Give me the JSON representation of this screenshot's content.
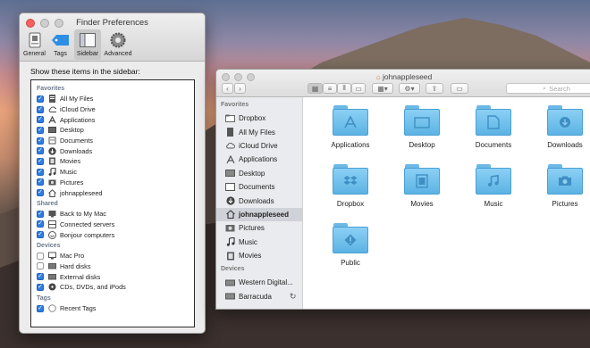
{
  "preferences": {
    "title": "Finder Preferences",
    "toolbar": [
      {
        "label": "General",
        "icon": "general-icon"
      },
      {
        "label": "Tags",
        "icon": "tag-icon"
      },
      {
        "label": "Sidebar",
        "icon": "sidebar-icon"
      },
      {
        "label": "Advanced",
        "icon": "gear-icon"
      }
    ],
    "heading": "Show these items in the sidebar:",
    "sections": {
      "favorites": {
        "title": "Favorites",
        "items": [
          {
            "label": "All My Files",
            "checked": true
          },
          {
            "label": "iCloud Drive",
            "checked": true
          },
          {
            "label": "Applications",
            "checked": true
          },
          {
            "label": "Desktop",
            "checked": true
          },
          {
            "label": "Documents",
            "checked": true
          },
          {
            "label": "Downloads",
            "checked": true
          },
          {
            "label": "Movies",
            "checked": true
          },
          {
            "label": "Music",
            "checked": true
          },
          {
            "label": "Pictures",
            "checked": true
          },
          {
            "label": "johnappleseed",
            "checked": true
          }
        ]
      },
      "shared": {
        "title": "Shared",
        "items": [
          {
            "label": "Back to My Mac",
            "checked": true
          },
          {
            "label": "Connected servers",
            "checked": true
          },
          {
            "label": "Bonjour computers",
            "checked": true
          }
        ]
      },
      "devices": {
        "title": "Devices",
        "items": [
          {
            "label": "Mac Pro",
            "checked": false
          },
          {
            "label": "Hard disks",
            "checked": false
          },
          {
            "label": "External disks",
            "checked": true
          },
          {
            "label": "CDs, DVDs, and iPods",
            "checked": true
          }
        ]
      },
      "tags": {
        "title": "Tags",
        "items": [
          {
            "label": "Recent Tags",
            "checked": true
          }
        ]
      }
    }
  },
  "finder": {
    "title": "johnappleseed",
    "search_placeholder": "Search",
    "sidebar": {
      "favorites_title": "Favorites",
      "favorites": [
        "Dropbox",
        "All My Files",
        "iCloud Drive",
        "Applications",
        "Desktop",
        "Documents",
        "Downloads",
        "johnappleseed",
        "Pictures",
        "Music",
        "Movies"
      ],
      "selected": "johnappleseed",
      "devices_title": "Devices",
      "devices": [
        "Western Digital...",
        "Barracuda"
      ]
    },
    "items": [
      "Applications",
      "Desktop",
      "Documents",
      "Downloads",
      "Dropbox",
      "Movies",
      "Music",
      "Pictures",
      "Public"
    ]
  },
  "colors": {
    "checkbox": "#2f7de1",
    "folder": "#6cbfee"
  }
}
